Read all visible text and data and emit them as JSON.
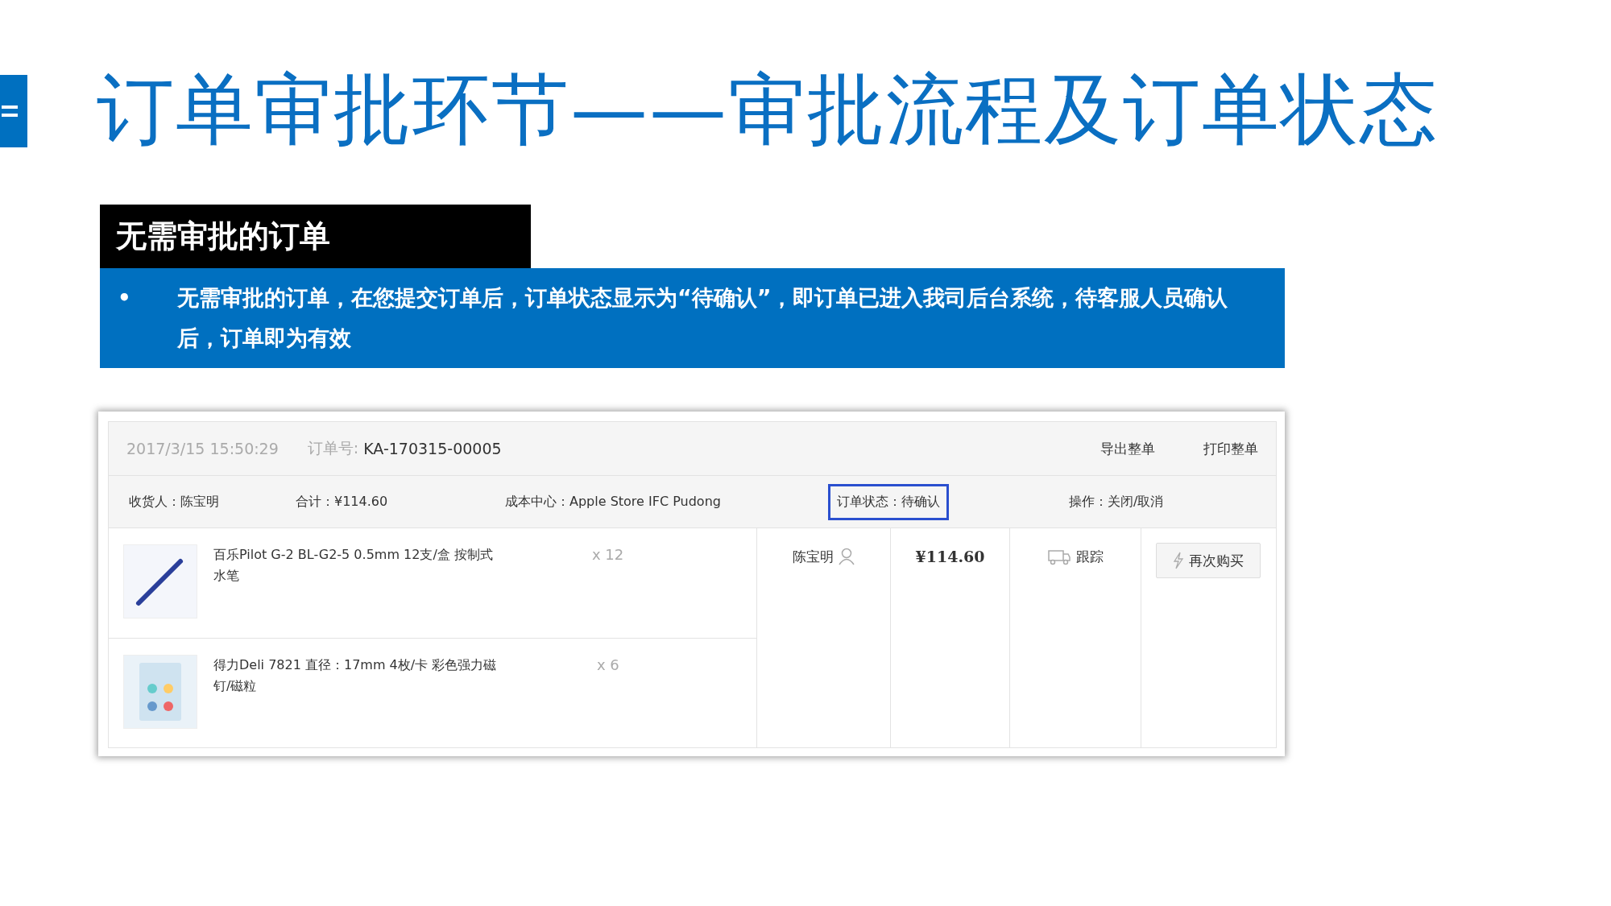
{
  "slide": {
    "title": "订单审批环节——审批流程及订单状态",
    "section_label": "无需审批的订单",
    "bullet_mark": "•",
    "bullet_text": "无需审批的订单，在您提交订单后，订单状态显示为“待确认”，即订单已进入我司后台系统，待客服人员确认后，订单即为有效"
  },
  "order": {
    "datetime": "2017/3/15 15:50:29",
    "order_no_label": "订单号:",
    "order_no": "KA-170315-00005",
    "actions": [
      "导出整单",
      "打印整单"
    ],
    "info": [
      {
        "text": "收货人：陈宝明",
        "highlighted": false
      },
      {
        "text": "合计：¥114.60",
        "highlighted": false
      },
      {
        "text": "成本中心：Apple Store IFC Pudong",
        "highlighted": false
      },
      {
        "text": "订单状态：待确认",
        "highlighted": true
      },
      {
        "text": "操作：关闭/取消",
        "highlighted": false
      }
    ],
    "items": [
      {
        "kind": "pen",
        "name": "百乐Pilot G-2 BL-G2-5 0.5mm 12支/盒 按制式水笔",
        "qty": "x 12"
      },
      {
        "kind": "magnet",
        "name": "得力Deli 7821 直径：17mm 4枚/卡 彩色强力磁钉/磁粒",
        "qty": "x 6"
      }
    ],
    "recipient": "陈宝明",
    "total": "¥114.60",
    "track": "跟踪",
    "rebuy": "再次购买"
  }
}
